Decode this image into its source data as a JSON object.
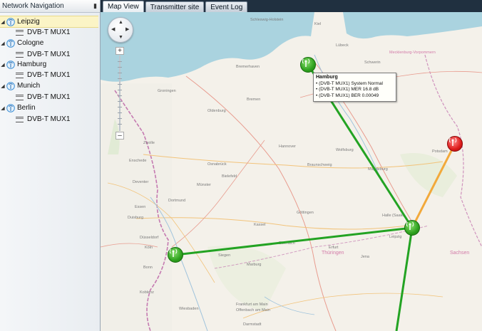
{
  "nav": {
    "title": "Network Navigation",
    "pin_glyph": "▮",
    "sites": [
      {
        "name": "Leipzig",
        "mux": "DVB-T MUX1",
        "selected": true
      },
      {
        "name": "Cologne",
        "mux": "DVB-T MUX1"
      },
      {
        "name": "Hamburg",
        "mux": "DVB-T MUX1"
      },
      {
        "name": "Munich",
        "mux": "DVB-T MUX1"
      },
      {
        "name": "Berlin",
        "mux": "DVB-T MUX1"
      }
    ]
  },
  "tabs": [
    {
      "label": "Map View",
      "active": true
    },
    {
      "label": "Transmitter site"
    },
    {
      "label": "Event Log"
    }
  ],
  "map": {
    "tooltip": {
      "title": "Hamburg",
      "lines": [
        "• (DVB-T MUX1) System Normal",
        "• (DVB-T MUX1) MER 16.8 dB",
        "• (DVB-T MUX1) BER 0.00049"
      ]
    },
    "status_colors": {
      "normal": "#2ea11e",
      "alarm": "#de1b1b",
      "warning_link": "#f2a93b",
      "ok_link": "#23a323"
    },
    "places": [
      "Schleswig-Holstein",
      "Kiel",
      "Lübeck",
      "Schwerin",
      "Bremerhaven",
      "Mecklenburg-Vorpommern",
      "Groningen",
      "Bremen",
      "Oldenburg",
      "Zwolle",
      "Enschede",
      "Deventer",
      "Osnabrück",
      "Hannover",
      "Wolfsburg",
      "Magdeburg",
      "Braunschweig",
      "Potsdam",
      "Bielefeld",
      "Münster",
      "Dortmund",
      "Essen",
      "Duisburg",
      "Göttingen",
      "Kassel",
      "Halle (Saale)",
      "Leipzig",
      "Düsseldorf",
      "Köln",
      "Eisenach",
      "Erfurt",
      "Jena",
      "Sachsen",
      "Bonn",
      "Siegen",
      "Marburg",
      "Thüringen",
      "Koblenz",
      "Frankfurt am Main",
      "Offenbach am Main",
      "Wiesbaden",
      "Darmstadt"
    ]
  }
}
